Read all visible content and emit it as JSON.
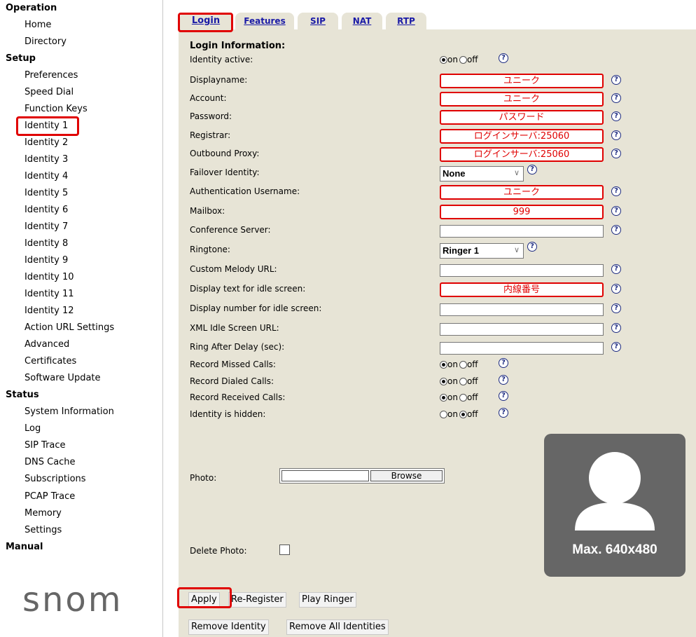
{
  "sidebar": {
    "operation": {
      "title": "Operation",
      "items": [
        "Home",
        "Directory"
      ]
    },
    "setup": {
      "title": "Setup",
      "items": [
        "Preferences",
        "Speed Dial",
        "Function Keys",
        "Identity 1",
        "Identity 2",
        "Identity 3",
        "Identity 4",
        "Identity 5",
        "Identity 6",
        "Identity 7",
        "Identity 8",
        "Identity 9",
        "Identity 10",
        "Identity 11",
        "Identity 12",
        "Action URL Settings",
        "Advanced",
        "Certificates",
        "Software Update"
      ]
    },
    "status": {
      "title": "Status",
      "items": [
        "System Information",
        "Log",
        "SIP Trace",
        "DNS Cache",
        "Subscriptions",
        "PCAP Trace",
        "Memory",
        "Settings"
      ]
    },
    "manual": {
      "title": "Manual"
    },
    "logo": "snom"
  },
  "tabs": [
    "Login",
    "Features",
    "SIP",
    "NAT",
    "RTP"
  ],
  "form": {
    "section_title": "Login Information:",
    "radio_on": "on",
    "radio_off": "off",
    "help_glyph": "?",
    "fields": [
      {
        "label": "Identity active:",
        "kind": "radio",
        "value": "on"
      },
      {
        "label": "Displayname:",
        "kind": "text",
        "value": "ユニーク"
      },
      {
        "label": "Account:",
        "kind": "text",
        "value": "ユニーク"
      },
      {
        "label": "Password:",
        "kind": "text",
        "value": "パスワード"
      },
      {
        "label": "Registrar:",
        "kind": "text",
        "value": "ログインサーバ:25060"
      },
      {
        "label": "Outbound Proxy:",
        "kind": "text",
        "value": "ログインサーバ:25060"
      },
      {
        "label": "Failover Identity:",
        "kind": "select",
        "value": "None"
      },
      {
        "label": "Authentication Username:",
        "kind": "text",
        "value": "ユニーク"
      },
      {
        "label": "Mailbox:",
        "kind": "text",
        "value": "999"
      },
      {
        "label": "Conference Server:",
        "kind": "text",
        "value": ""
      },
      {
        "label": "Ringtone:",
        "kind": "select",
        "value": "Ringer 1"
      },
      {
        "label": "Custom Melody URL:",
        "kind": "text",
        "value": ""
      },
      {
        "label": "Display text for idle screen:",
        "kind": "text",
        "value": "内線番号"
      },
      {
        "label": "Display number for idle screen:",
        "kind": "text",
        "value": ""
      },
      {
        "label": "XML Idle Screen URL:",
        "kind": "text",
        "value": ""
      },
      {
        "label": "Ring After Delay (sec):",
        "kind": "text",
        "value": ""
      },
      {
        "label": "Record Missed Calls:",
        "kind": "radio",
        "value": "on"
      },
      {
        "label": "Record Dialed Calls:",
        "kind": "radio",
        "value": "on"
      },
      {
        "label": "Record Received Calls:",
        "kind": "radio",
        "value": "on"
      },
      {
        "label": "Identity is hidden:",
        "kind": "radio",
        "value": "off"
      }
    ],
    "photo_label": "Photo:",
    "browse_label": "Browse",
    "delete_photo_label": "Delete Photo:",
    "avatar_caption": "Max. 640x480"
  },
  "buttons": {
    "apply": "Apply",
    "reregister": "Re-Register",
    "play_ringer": "Play Ringer",
    "remove_identity": "Remove Identity",
    "remove_all": "Remove All Identities"
  },
  "colors": {
    "panel": "#e7e4d6",
    "highlight": "#e00000",
    "link": "#1a1aa6"
  }
}
